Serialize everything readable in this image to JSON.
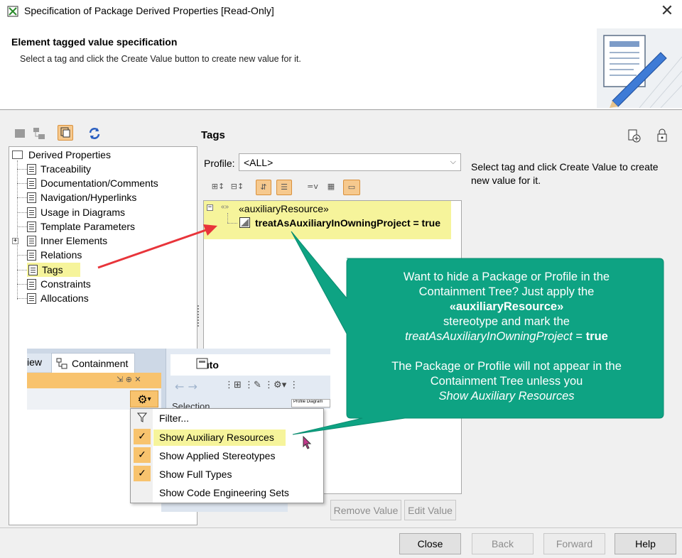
{
  "window": {
    "title": "Specification of Package Derived Properties [Read-Only]",
    "close_glyph": "✕"
  },
  "header": {
    "title": "Element tagged value specification",
    "subtitle": "Select a tag and click the Create Value button to create new value for it.",
    "art_icon": "document-pencil-icon"
  },
  "left_toolbar": {
    "icons": [
      "grid-icon",
      "tree-view-icon",
      "compact-view-icon",
      "refresh-icon"
    ]
  },
  "tree": {
    "root": "Derived Properties",
    "items": [
      {
        "label": "Traceability"
      },
      {
        "label": "Documentation/Comments"
      },
      {
        "label": "Navigation/Hyperlinks"
      },
      {
        "label": "Usage in Diagrams"
      },
      {
        "label": "Template Parameters"
      },
      {
        "label": "Inner Elements"
      },
      {
        "label": "Relations"
      },
      {
        "label": "Tags"
      },
      {
        "label": "Constraints"
      },
      {
        "label": "Allocations"
      }
    ],
    "selected": "Tags"
  },
  "right_panel": {
    "title": "Tags",
    "profile_label": "Profile:",
    "profile_value": "<ALL>",
    "stereotype": "«auxiliaryResource»",
    "tag_value": "treatAsAuxiliaryInOwningProject = true",
    "description": "Select tag and click Create Value to create new value for it.",
    "header_icons": [
      "import-icon",
      "lock-icon"
    ]
  },
  "buttons": {
    "remove_value": "Remove Value",
    "edit_value": "Edit Value"
  },
  "inset": {
    "partial_tab": "iew",
    "containment_tab": "Containment",
    "auto_tab": "Auto",
    "selection_label": "Selection",
    "profile_diagram_label": "Profile Diagram"
  },
  "menu": {
    "items": [
      {
        "label": "Filter...",
        "checked": false
      },
      {
        "label": "Show Auxiliary Resources",
        "checked": true
      },
      {
        "label": "Show Applied Stereotypes",
        "checked": true
      },
      {
        "label": "Show Full Types",
        "checked": true
      },
      {
        "label": "Show Code Engineering Sets",
        "checked": false
      }
    ],
    "highlighted": "Show Auxiliary Resources"
  },
  "callout": {
    "line1": "Want to hide a Package or Profile in the",
    "line2": "Containment Tree? Just apply the",
    "line3": "«auxiliaryResource»",
    "line4": "stereotype and mark the",
    "line5_italic": "treatAsAuxiliaryInOwningProject",
    "line5_rest": " = ",
    "line5_bold": "true",
    "line6": "The Package or Profile will not appear in the",
    "line7": "Containment Tree unless you",
    "line8": "Show Auxiliary Resources",
    "color": "#0ea383"
  },
  "footer": {
    "close": "Close",
    "back": "Back",
    "forward": "Forward",
    "help": "Help"
  },
  "colors": {
    "highlight": "#f6f49b",
    "selected_button": "#f6c98e",
    "arrow": "#e8343a"
  }
}
